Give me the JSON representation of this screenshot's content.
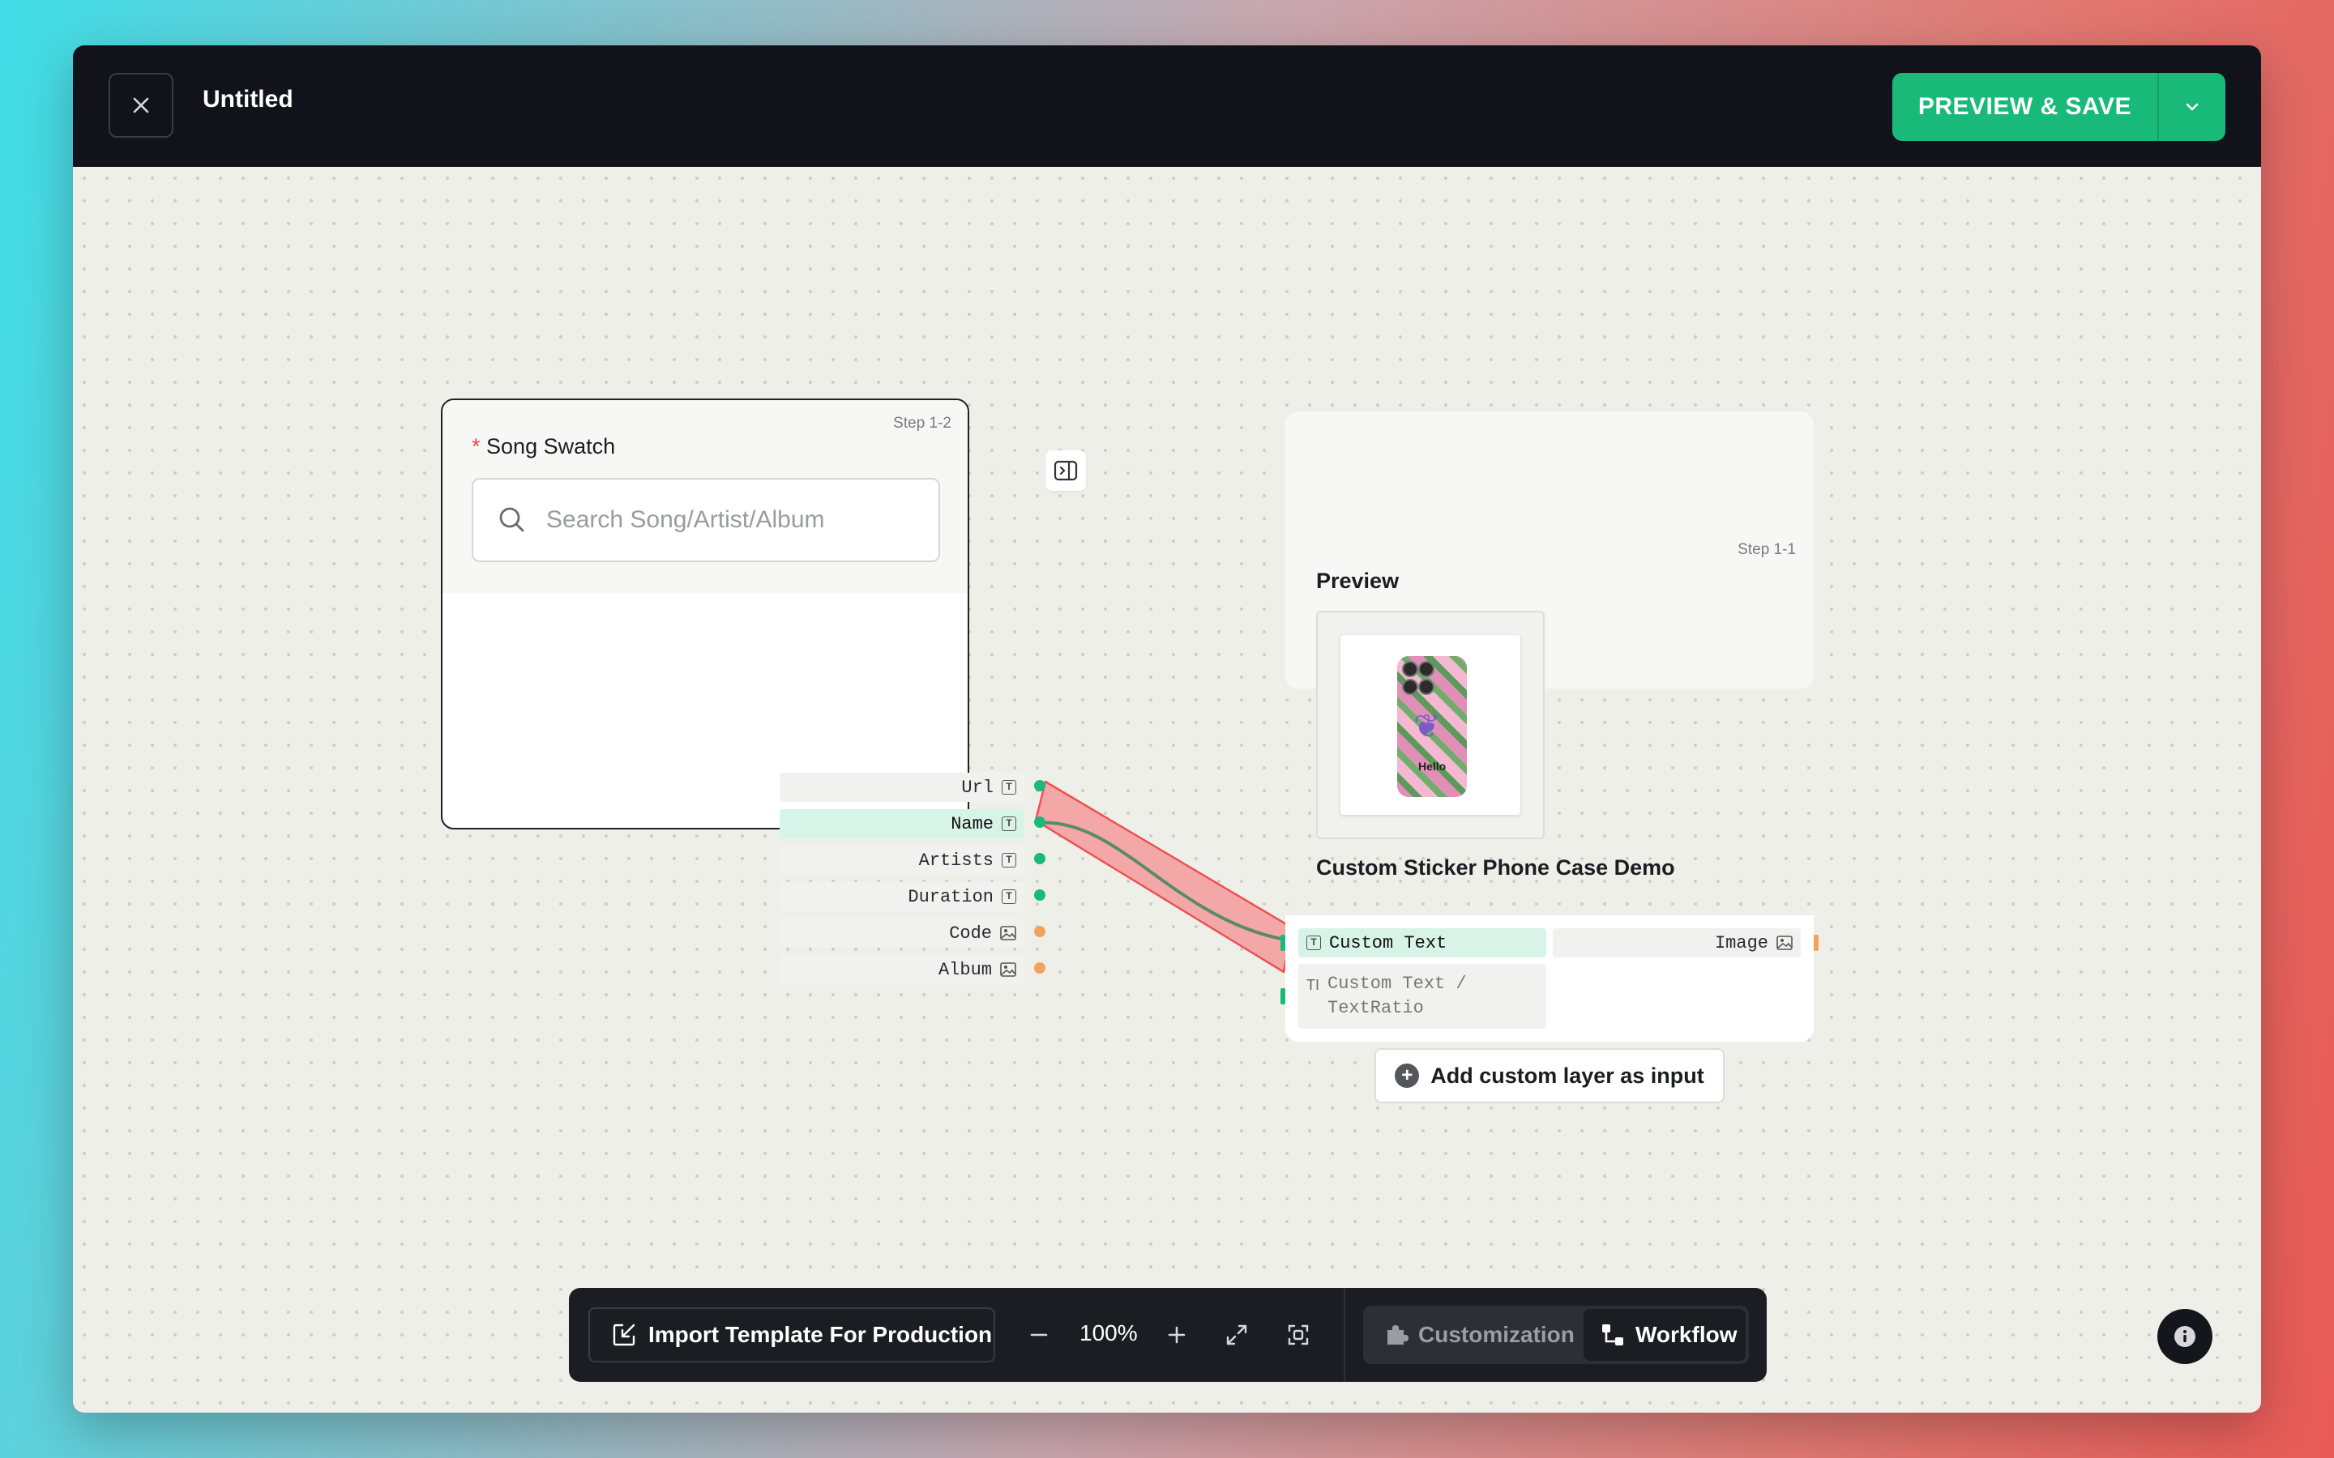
{
  "header": {
    "title": "Untitled",
    "save_label": "PREVIEW & SAVE",
    "close_icon": "close-icon",
    "dropdown_icon": "chevron-down-icon"
  },
  "nodes": {
    "song_swatch": {
      "step": "Step 1-2",
      "required_mark": "*",
      "title": "Song Swatch",
      "search_placeholder": "Search Song/Artist/Album",
      "outputs": [
        {
          "label": "Url",
          "type": "text",
          "color": "#19b97a"
        },
        {
          "label": "Name",
          "type": "text",
          "color": "#19b97a",
          "active": true
        },
        {
          "label": "Artists",
          "type": "text",
          "color": "#19b97a"
        },
        {
          "label": "Duration",
          "type": "text",
          "color": "#19b97a"
        },
        {
          "label": "Code",
          "type": "image",
          "color": "#f4a259"
        },
        {
          "label": "Album",
          "type": "image",
          "color": "#f4a259"
        }
      ]
    },
    "preview": {
      "step": "Step 1-1",
      "title": "Preview",
      "product_name": "Custom Sticker Phone Case Demo",
      "sticker_text": "Hello",
      "inputs": [
        {
          "label": "Custom Text",
          "type": "text"
        },
        {
          "label": "Image",
          "type": "image"
        },
        {
          "label": "Custom Text / TextRatio",
          "type": "text-ratio"
        }
      ],
      "add_layer_label": "Add custom layer as input"
    }
  },
  "toolbar": {
    "import_label": "Import Template For Production",
    "zoom": "100%",
    "mode_customization": "Customization",
    "mode_workflow": "Workflow",
    "active_mode": "Workflow"
  },
  "colors": {
    "accent": "#19b97a",
    "connection_highlight": "#f28b8b",
    "text_port": "#19b97a",
    "image_port": "#f4a259"
  }
}
